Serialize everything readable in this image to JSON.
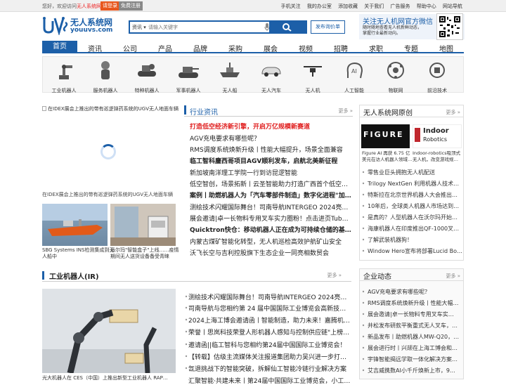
{
  "topbar": {
    "welcome_prefix": "您好，欢迎访问",
    "welcome_site": "无人系统网!",
    "login": "请登录",
    "register": "免费注册",
    "links": [
      "手机关注",
      "我的办公室",
      "添加收藏",
      "关于我们",
      "广告服务",
      "帮助中心",
      "网站导航"
    ]
  },
  "logo": {
    "cn": "无人系统网",
    "en": "youuvs.com"
  },
  "search": {
    "category": "资讯",
    "placeholder": "请输入关键字"
  },
  "publish_label": "发布询价单",
  "wechat": {
    "title": "关注无人机网官方微信",
    "line1": "随时随地查看无人机新鲜动态，",
    "line2": "掌握行业最新动向。"
  },
  "nav": [
    "首页",
    "资讯",
    "公司",
    "产品",
    "品牌",
    "采购",
    "展会",
    "视频",
    "招聘",
    "求职",
    "专题",
    "地图"
  ],
  "categories": [
    "工业机器人",
    "服务机器人",
    "特种机器人",
    "军事机器人",
    "无人船",
    "无人汽车",
    "无人机",
    "人工智能",
    "物联网",
    "前沿技术"
  ],
  "hero": {
    "alt": "在IDEX展会上推出的带有巡逻弹药系统的UGV无人地面车辆",
    "caption": "在IDEX展会上推出的带有巡逻弹药系统的UGV无人地面车辆"
  },
  "thumbs": [
    {
      "caption1": "SBG Systems INS检测集成到无",
      "caption2": "人船中"
    },
    {
      "caption1": "派尔玛\"智能盒子\"上线……疫情",
      "caption2": "期间无人送货设备备受青睐"
    }
  ],
  "industry_news": {
    "title": "行业资讯",
    "more": "更多 »",
    "items": [
      "打造低空经济新引擎，开启万亿规模新赛道",
      "AGV充电要求有哪些呢？",
      "RMS调度系统焕新升级丨性能大幅提升，场景全面兼容",
      "临工智科鏖西哥项目AGV顺利发车，启航北美新征程",
      "新加坡南洋理工学院一行到访昆逻智能",
      "低空智创，场景拓新丨云圣智能助力打造广西首个低空…",
      "案例丨助燃机器人为「汽车零部件制造」数字化进程\"加…",
      "测绘技术闪耀国际舞台！司南导航INTERGEO 2024亮…",
      "展会邀请|卓一长物料专用叉车实力圈粉！点击进页Tube…",
      "Quicktron快仓：移动机器人正在成为可持续仓储的基…",
      "内蒙古煤矿智能化转型，无人机巡检高效护航矿山安全",
      "沃飞长空与吉利控股旗下生态企业一同亮相数贸会"
    ]
  },
  "original": {
    "title": "无人系统网原创",
    "more": "更多 »",
    "img1": "FIGURE",
    "img2_line1": "Indoor",
    "img2_line2": "Robotics",
    "cap1a": "Figure AI 再获 6.75 亿",
    "cap1b": "美元在访人机器人领域…",
    "cap2a": "Indoor-robotics吸顶式",
    "cap2b": "无人机，改变游戏规…",
    "items": [
      "零售业巨头拥抱无人机配送",
      "Trilogy NextGen 利用机器人技术…",
      "特斯拉在北京世界机器人大会推出…",
      "10年后，全球类人机器人市场达到…",
      "是真的？人型机器人在沃尔玛开始…",
      "海康机器人在印度推出QF-1000叉…",
      "了解武装机器狗！",
      "Window Hero宣布将部署Lucid Bot…"
    ]
  },
  "company_news": {
    "title": "企业动态",
    "more": "更多 »",
    "items": [
      "AGV充电要求有哪些呢？",
      "RMS调度系统焕新升级丨性能大幅…",
      "展会邀请|卓一长物料专用叉车实…",
      "井松发布研款平衡重式无人叉车，…",
      "新品发布丨助燃机器人MW-Q20，…",
      "展会进行时丨兴颉在上海工博会和…",
      "宇锋智能揭远学取一体化解决方案…",
      "艾吉威携数AI小千斤焕新上市，9…"
    ]
  },
  "industrial_robot": {
    "title": "工业机器人(IR)",
    "more": "更多 »",
    "caption": "光大机器人在 CES（中国）上推出新型工业机器人 RAP…",
    "items": [
      "测绘技术闪耀国际舞台！司南导航INTERGEO 2024亮点…",
      "司南导航与您相约第 24 届中国国际工业博览会高新技术…",
      "2024上海工博会邀请函丨智能制造，助力未来！嘉腾机…",
      "荣誉丨思岚科技荣登人形机器人感知与控制供应链\"上榜…",
      "邀请函||临工智科与您相约第24届中国国际工业博览会！",
      "【转载】估级主流媒体关注报道集团助力吴兴进一步打…",
      "氙退挑战下的智能突破，拆解仙工智能冷链行业解决方案",
      "汇聚智能·共建未来丨第24届中国国际工业博览会，小工…"
    ]
  }
}
